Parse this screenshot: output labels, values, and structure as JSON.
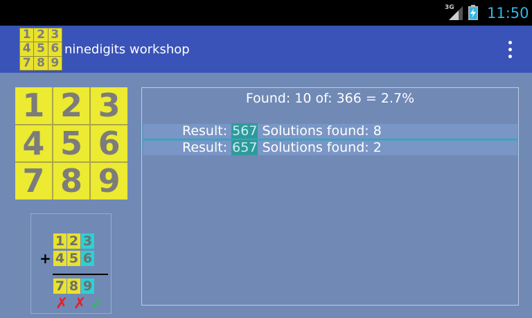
{
  "status_bar": {
    "network_type": "3G",
    "signal_icon": "signal-bars-icon",
    "battery_icon": "battery-charging-icon",
    "time": "11:50"
  },
  "action_bar": {
    "logo_digits": [
      "1",
      "2",
      "3",
      "4",
      "5",
      "6",
      "7",
      "8",
      "9"
    ],
    "title": "ninedigits workshop",
    "menu_icon": "overflow-menu-icon"
  },
  "digit_grid": [
    "1",
    "2",
    "3",
    "4",
    "5",
    "6",
    "7",
    "8",
    "9"
  ],
  "example": {
    "row1": [
      "1",
      "2",
      "3"
    ],
    "row2": [
      "4",
      "5",
      "6"
    ],
    "row3": [
      "7",
      "8",
      "9"
    ],
    "operator": "+",
    "marks": [
      "✗",
      "✗",
      "✓"
    ]
  },
  "results": {
    "summary": "Found: 10 of: 366 = 2.7%",
    "rows": [
      {
        "prefix": "Result: ",
        "number": "567",
        "suffix": " Solutions found: 8"
      },
      {
        "prefix": "Result: ",
        "number": "657",
        "suffix": " Solutions found: 2"
      }
    ]
  },
  "colors": {
    "background": "#7189b5",
    "action_bar": "#3a53b8",
    "tile_yellow": "#ecea31",
    "tile_cyan": "#2dd0d4",
    "clock": "#33b5e5"
  }
}
